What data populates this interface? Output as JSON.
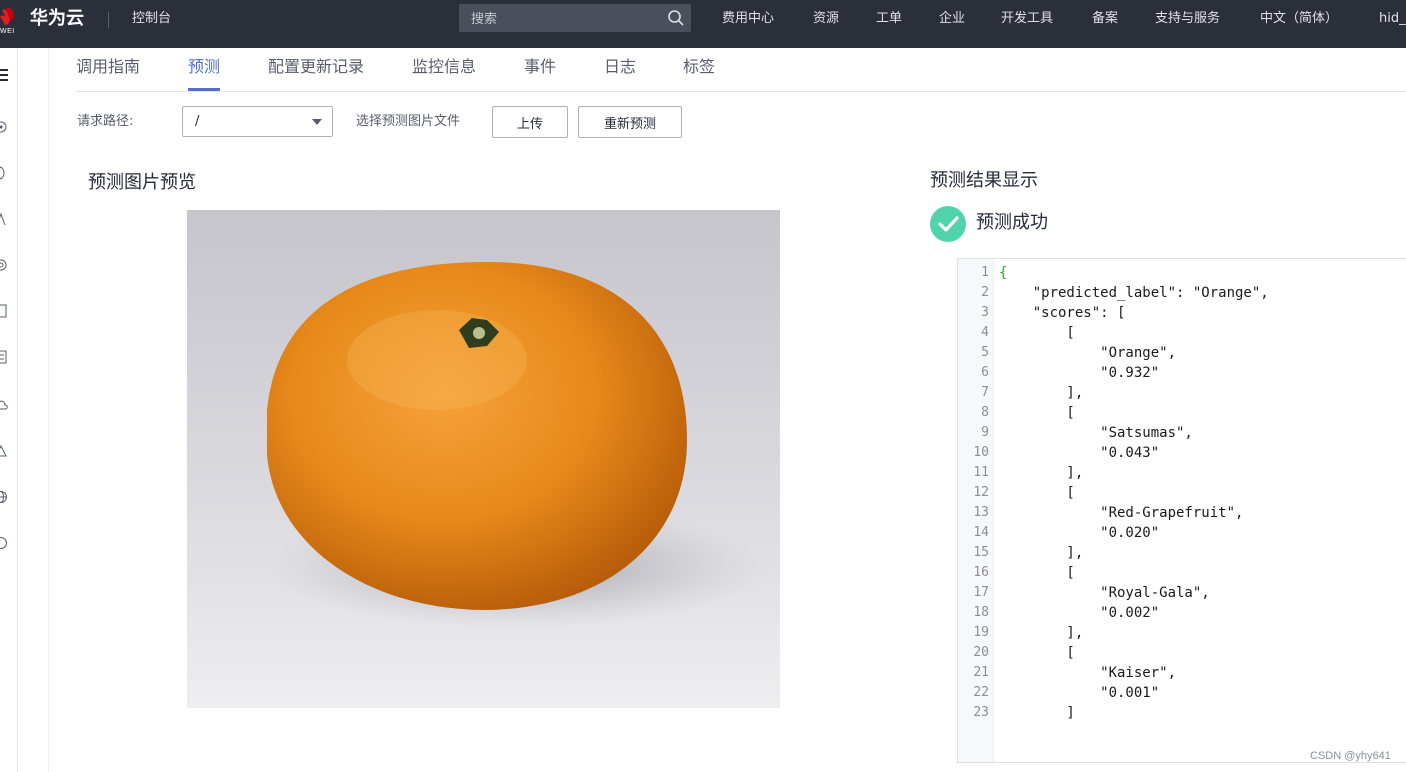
{
  "topbar": {
    "logo_small": "WEI",
    "brand": "华为云",
    "console": "控制台",
    "search_placeholder": "搜索",
    "nav": [
      "费用中心",
      "资源",
      "工单",
      "企业",
      "开发工具",
      "备案",
      "支持与服务",
      "中文（简体）",
      "hid_"
    ]
  },
  "tabs": [
    "调用指南",
    "预测",
    "配置更新记录",
    "监控信息",
    "事件",
    "日志",
    "标签"
  ],
  "active_tab": "预测",
  "request": {
    "path_label": "请求路径:",
    "path_value": "/",
    "choose_label": "选择预测图片文件",
    "upload_button": "上传",
    "repredict_button": "重新预测"
  },
  "preview": {
    "title": "预测图片预览"
  },
  "result": {
    "title": "预测结果显示",
    "status": "预测成功",
    "lines": [
      "{",
      "    \"predicted_label\": \"Orange\",",
      "    \"scores\": [",
      "        [",
      "            \"Orange\",",
      "            \"0.932\"",
      "        ],",
      "        [",
      "            \"Satsumas\",",
      "            \"0.043\"",
      "        ],",
      "        [",
      "            \"Red-Grapefruit\",",
      "            \"0.020\"",
      "        ],",
      "        [",
      "            \"Royal-Gala\",",
      "            \"0.002\"",
      "        ],",
      "        [",
      "            \"Kaiser\",",
      "            \"0.001\"",
      "        ]"
    ]
  },
  "watermark": "CSDN @yhy641",
  "colors": {
    "topbar_bg": "#2b2f3a",
    "accent": "#526ecc",
    "success": "#50d4ab",
    "brand_red": "#e02020"
  }
}
